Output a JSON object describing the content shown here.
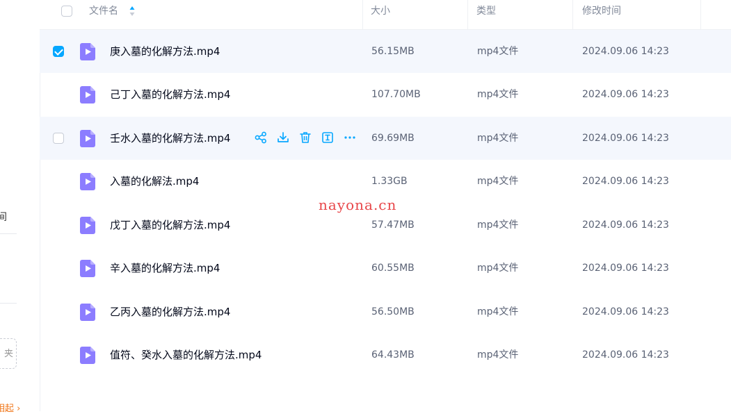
{
  "sidebar": {
    "frag_label": "间",
    "dashed_btn": "夹",
    "orange_link": "相起 ›"
  },
  "header": {
    "col_name": "文件名",
    "col_size": "大小",
    "col_type": "类型",
    "col_time": "修改时间"
  },
  "files": [
    {
      "name": "庚入墓的化解方法.mp4",
      "size": "56.15MB",
      "type": "mp4文件",
      "time": "2024.09.06 14:23",
      "checked": true
    },
    {
      "name": "己丁入墓的化解方法.mp4",
      "size": "107.70MB",
      "type": "mp4文件",
      "time": "2024.09.06 14:23"
    },
    {
      "name": "壬水入墓的化解方法.mp4",
      "size": "69.69MB",
      "type": "mp4文件",
      "time": "2024.09.06 14:23",
      "hovered": true
    },
    {
      "name": "入墓的化解法.mp4",
      "size": "1.33GB",
      "type": "mp4文件",
      "time": "2024.09.06 14:23"
    },
    {
      "name": "戊丁入墓的化解方法.mp4",
      "size": "57.47MB",
      "type": "mp4文件",
      "time": "2024.09.06 14:23"
    },
    {
      "name": "辛入墓的化解方法.mp4",
      "size": "60.55MB",
      "type": "mp4文件",
      "time": "2024.09.06 14:23"
    },
    {
      "name": "乙丙入墓的化解方法.mp4",
      "size": "56.50MB",
      "type": "mp4文件",
      "time": "2024.09.06 14:23"
    },
    {
      "name": "值符、癸水入墓的化解方法.mp4",
      "size": "64.43MB",
      "type": "mp4文件",
      "time": "2024.09.06 14:23"
    }
  ],
  "row_actions": [
    "share-icon",
    "download-icon",
    "delete-icon",
    "rename-icon",
    "more-icon"
  ],
  "watermark": "nayona.cn",
  "colors": {
    "accent": "#06a7ff",
    "file_icon": "#8c7dff",
    "selected_row": "#f4f7fd",
    "watermark": "#e8474a"
  }
}
